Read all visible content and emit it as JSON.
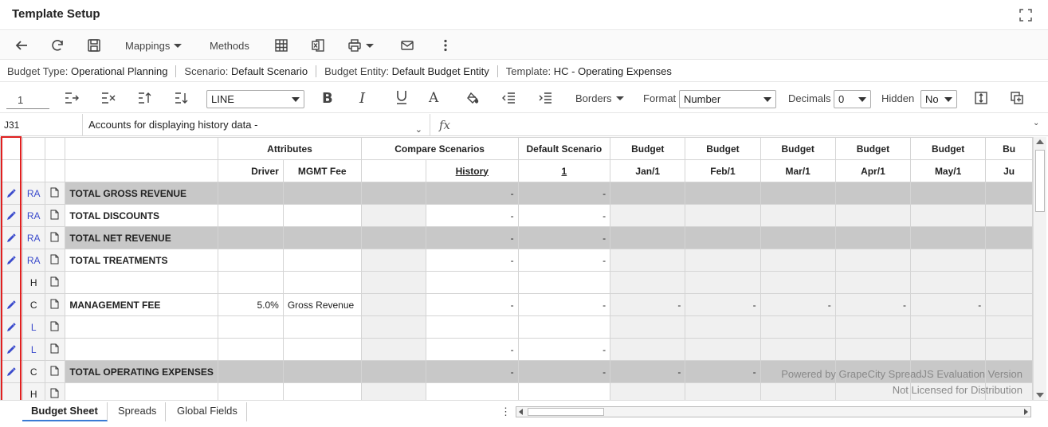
{
  "window": {
    "title": "Template Setup"
  },
  "toolbar": {
    "mappings_label": "Mappings",
    "methods_label": "Methods"
  },
  "info": [
    {
      "label": "Budget Type: ",
      "value": "Operational Planning"
    },
    {
      "label": "Scenario: ",
      "value": "Default Scenario"
    },
    {
      "label": "Budget Entity: ",
      "value": "Default Budget Entity"
    },
    {
      "label": "Template: ",
      "value": "HC - Operating Expenses"
    }
  ],
  "format": {
    "font_size": "1",
    "font_name": "LINE",
    "borders_label": "Borders",
    "format_label": "Format",
    "format_value": "Number",
    "decimals_label": "Decimals",
    "decimals_value": "0",
    "hidden_label": "Hidden",
    "hidden_value": "No"
  },
  "formula": {
    "cell_ref": "J31",
    "cell_name": "Accounts for displaying history data -"
  },
  "header": {
    "group_row": [
      "Attributes",
      "Compare Scenarios",
      "Default Scenario",
      "Budget",
      "Budget",
      "Budget",
      "Budget",
      "Budget",
      "Bu"
    ],
    "sub_row": [
      "Driver",
      "MGMT Fee",
      "History",
      "1",
      "Jan/1",
      "Feb/1",
      "Mar/1",
      "Apr/1",
      "May/1",
      "Ju"
    ]
  },
  "rows": [
    {
      "type": "RA",
      "name": "TOTAL GROSS REVENUE",
      "driver": "",
      "mgmt": "",
      "history": "-",
      "default": "-",
      "months": [
        "",
        "",
        "",
        "",
        ""
      ],
      "gray": true,
      "editable": true
    },
    {
      "type": "RA",
      "name": "TOTAL DISCOUNTS",
      "driver": "",
      "mgmt": "",
      "history": "-",
      "default": "-",
      "months": [
        "",
        "",
        "",
        "",
        ""
      ],
      "gray": false,
      "editable": true
    },
    {
      "type": "RA",
      "name": "TOTAL NET REVENUE",
      "driver": "",
      "mgmt": "",
      "history": "-",
      "default": "-",
      "months": [
        "",
        "",
        "",
        "",
        ""
      ],
      "gray": true,
      "editable": true
    },
    {
      "type": "RA",
      "name": "TOTAL TREATMENTS",
      "driver": "",
      "mgmt": "",
      "history": "-",
      "default": "-",
      "months": [
        "",
        "",
        "",
        "",
        ""
      ],
      "gray": false,
      "editable": true
    },
    {
      "type": "H",
      "name": "",
      "driver": "",
      "mgmt": "",
      "history": "",
      "default": "",
      "months": [
        "",
        "",
        "",
        "",
        ""
      ],
      "gray": false,
      "editable": false
    },
    {
      "type": "C",
      "name": "MANAGEMENT FEE",
      "driver": "5.0%",
      "mgmt": "Gross Revenue",
      "history": "-",
      "default": "-",
      "months": [
        "-",
        "-",
        "-",
        "-",
        "-"
      ],
      "gray": false,
      "editable": true
    },
    {
      "type": "L",
      "name": "",
      "driver": "",
      "mgmt": "",
      "history": "",
      "default": "",
      "months": [
        "",
        "",
        "",
        "",
        ""
      ],
      "gray": false,
      "editable": true
    },
    {
      "type": "L",
      "name": "",
      "driver": "",
      "mgmt": "",
      "history": "-",
      "default": "-",
      "months": [
        "",
        "",
        "",
        "",
        ""
      ],
      "gray": false,
      "editable": true
    },
    {
      "type": "C",
      "name": "TOTAL OPERATING EXPENSES",
      "driver": "",
      "mgmt": "",
      "history": "-",
      "default": "-",
      "months": [
        "-",
        "-",
        "",
        "",
        ""
      ],
      "gray": true,
      "editable": true
    },
    {
      "type": "H",
      "name": "",
      "driver": "",
      "mgmt": "",
      "history": "",
      "default": "",
      "months": [
        "",
        "",
        "",
        "",
        ""
      ],
      "gray": false,
      "editable": false
    }
  ],
  "watermark": {
    "line1": "Powered by GrapeCity SpreadJS Evaluation Version",
    "line2": "Not Licensed for Distribution"
  },
  "tabs": [
    "Budget Sheet",
    "Spreads",
    "Global Fields"
  ],
  "colors": {
    "accent_blue": "#3b4bcc",
    "highlight_red": "#e02020",
    "gray_row": "#c8c8c8"
  }
}
